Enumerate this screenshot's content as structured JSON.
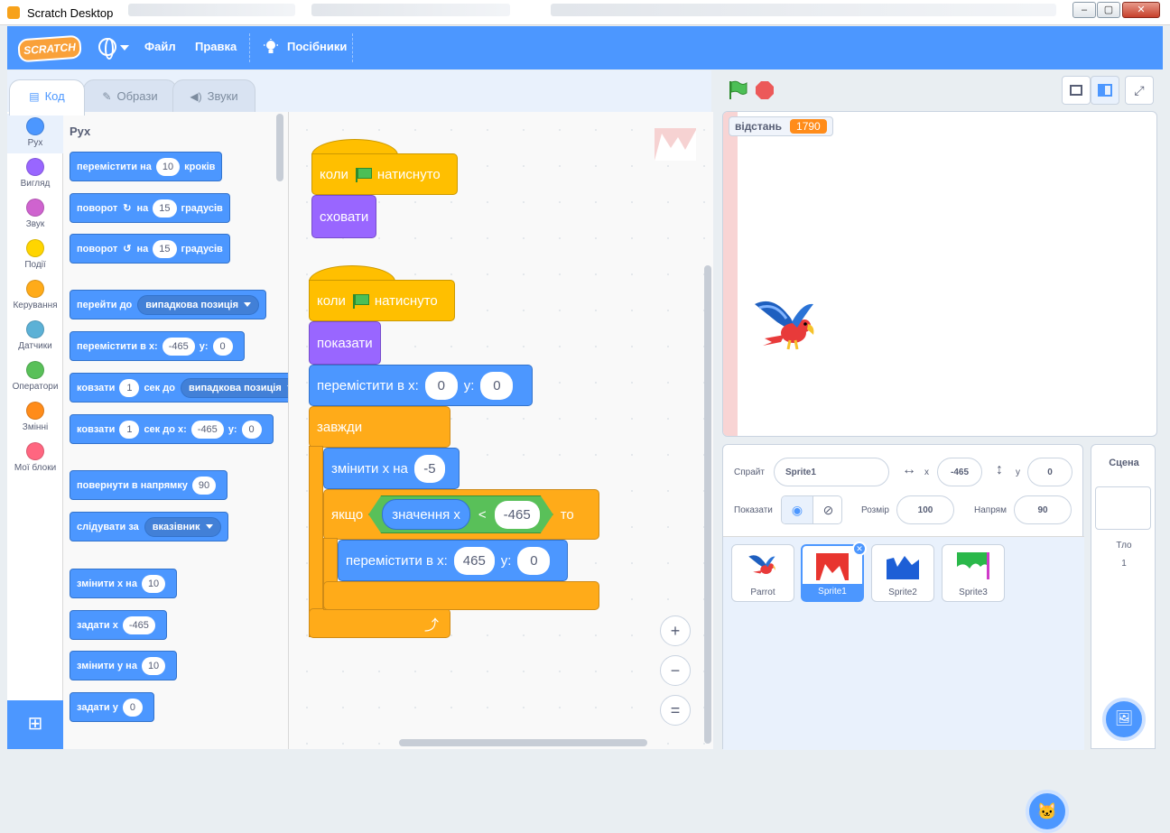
{
  "window": {
    "title": "Scratch Desktop",
    "min": "‒",
    "max": "▢",
    "close": "✕"
  },
  "menubar": {
    "logo": "SCRATCH",
    "file": "Файл",
    "edit": "Правка",
    "tutorials": "Посібники"
  },
  "tabs": [
    {
      "label": "Код",
      "icon": "code-icon"
    },
    {
      "label": "Образи",
      "icon": "costume-brush-icon"
    },
    {
      "label": "Звуки",
      "icon": "speaker-icon"
    }
  ],
  "categories": [
    {
      "label": "Рух",
      "color": "#4c97ff"
    },
    {
      "label": "Вигляд",
      "color": "#9966ff"
    },
    {
      "label": "Звук",
      "color": "#cf63cf"
    },
    {
      "label": "Події",
      "color": "#ffd500"
    },
    {
      "label": "Керування",
      "color": "#ffab19"
    },
    {
      "label": "Датчики",
      "color": "#5cb1d6"
    },
    {
      "label": "Оператори",
      "color": "#59c059"
    },
    {
      "label": "Змінні",
      "color": "#ff8c1a"
    },
    {
      "label": "Мої блоки",
      "color": "#ff6680"
    }
  ],
  "palette": {
    "heading": "Рух",
    "move": {
      "a": "перемістити на",
      "v": "10",
      "b": "кроків"
    },
    "turn_r": {
      "a": "поворот",
      "b": "на",
      "v": "15",
      "c": "градусів"
    },
    "turn_l": {
      "a": "поворот",
      "b": "на",
      "v": "15",
      "c": "градусів"
    },
    "goto": {
      "a": "перейти до",
      "d": "випадкова позиція"
    },
    "gotoxy": {
      "a": "перемістити в x:",
      "x": "-465",
      "b": "y:",
      "y": "0"
    },
    "glide": {
      "a": "ковзати",
      "v": "1",
      "b": "сек до",
      "d": "випадкова позиція"
    },
    "glidexy": {
      "a": "ковзати",
      "v": "1",
      "b": "сек до x:",
      "x": "-465",
      "c": "y:",
      "y": "0"
    },
    "point": {
      "a": "повернути в напрямку",
      "v": "90"
    },
    "follow": {
      "a": "слідувати за",
      "d": "вказівник"
    },
    "changex": {
      "a": "змінити х на",
      "v": "10"
    },
    "setx": {
      "a": "задати х",
      "v": "-465"
    },
    "changey": {
      "a": "змінити у на",
      "v": "10"
    },
    "sety": {
      "a": "задати у",
      "v": "0"
    }
  },
  "script1": {
    "when": "коли",
    "clicked": "натиснуто",
    "hide": "сховати"
  },
  "script2": {
    "when": "коли",
    "clicked": "натиснуто",
    "show": "показати",
    "goto": "перемістити в x:",
    "x": "0",
    "ylab": "у:",
    "y": "0",
    "forever": "завжди",
    "changex": "змінити х на",
    "cx": "-5",
    "if": "якщо",
    "reporter": "значення х",
    "lt": "<",
    "cmp": "-465",
    "then": "то",
    "goto2": "перемістити в x:",
    "x2": "465",
    "ylab2": "у:",
    "y2": "0"
  },
  "zoom": {
    "in": "+",
    "out": "−",
    "reset": "="
  },
  "stage": {
    "monitor_label": "відстань",
    "monitor_value": "1790"
  },
  "sprite_info": {
    "sprite_label": "Спрайт",
    "sprite_name": "Sprite1",
    "x_label": "x",
    "x": "-465",
    "y_label": "у",
    "y": "0",
    "show_label": "Показати",
    "size_label": "Розмір",
    "size": "100",
    "dir_label": "Напрям",
    "direction": "90"
  },
  "sprites": [
    {
      "name": "Parrot",
      "selected": false
    },
    {
      "name": "Sprite1",
      "selected": true
    },
    {
      "name": "Sprite2",
      "selected": false
    },
    {
      "name": "Sprite3",
      "selected": false
    }
  ],
  "scene": {
    "title": "Сцена",
    "backdrops_label": "Тло",
    "backdrops_count": "1"
  }
}
